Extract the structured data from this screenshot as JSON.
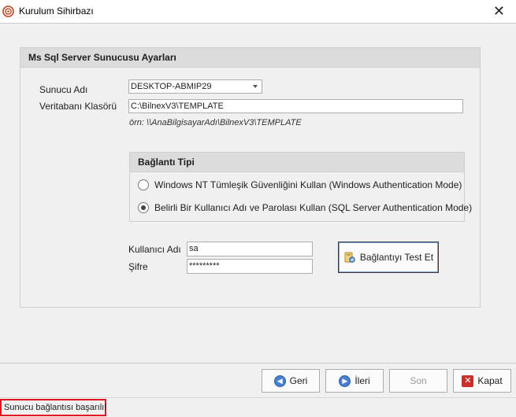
{
  "window": {
    "title": "Kurulum Sihirbazı",
    "icon": "setup-wizard-icon",
    "close_icon": "close-icon"
  },
  "group": {
    "header": "Ms Sql Server Sunucusu Ayarları",
    "server_label": "Sunucu Adı",
    "server_value": "DESKTOP-ABMIP29",
    "db_folder_label": "Veritabanı Klasörü",
    "db_folder_value": "C:\\BilnexV3\\TEMPLATE",
    "example": "örn: \\\\AnaBilgisayarAdı\\BilnexV3\\TEMPLATE"
  },
  "connection": {
    "header": "Bağlantı Tipi",
    "options": [
      {
        "label": "Windows NT Tümleşik Güvenliğini Kullan (Windows Authentication Mode)",
        "checked": false
      },
      {
        "label": "Belirli Bir Kullanıcı Adı ve Parolası Kullan (SQL Server Authentication Mode)",
        "checked": true
      }
    ]
  },
  "credentials": {
    "user_label": "Kullanıcı Adı",
    "user_value": "sa",
    "password_label": "Şifre",
    "password_value": "*********",
    "test_button": "Bağlantıyı Test Et"
  },
  "footer": {
    "back": "Geri",
    "next": "İleri",
    "finish": "Son",
    "close": "Kapat"
  },
  "status": {
    "text": "Sunucu bağlantısı başarılı!",
    "highlight_color": "#e0141e"
  }
}
